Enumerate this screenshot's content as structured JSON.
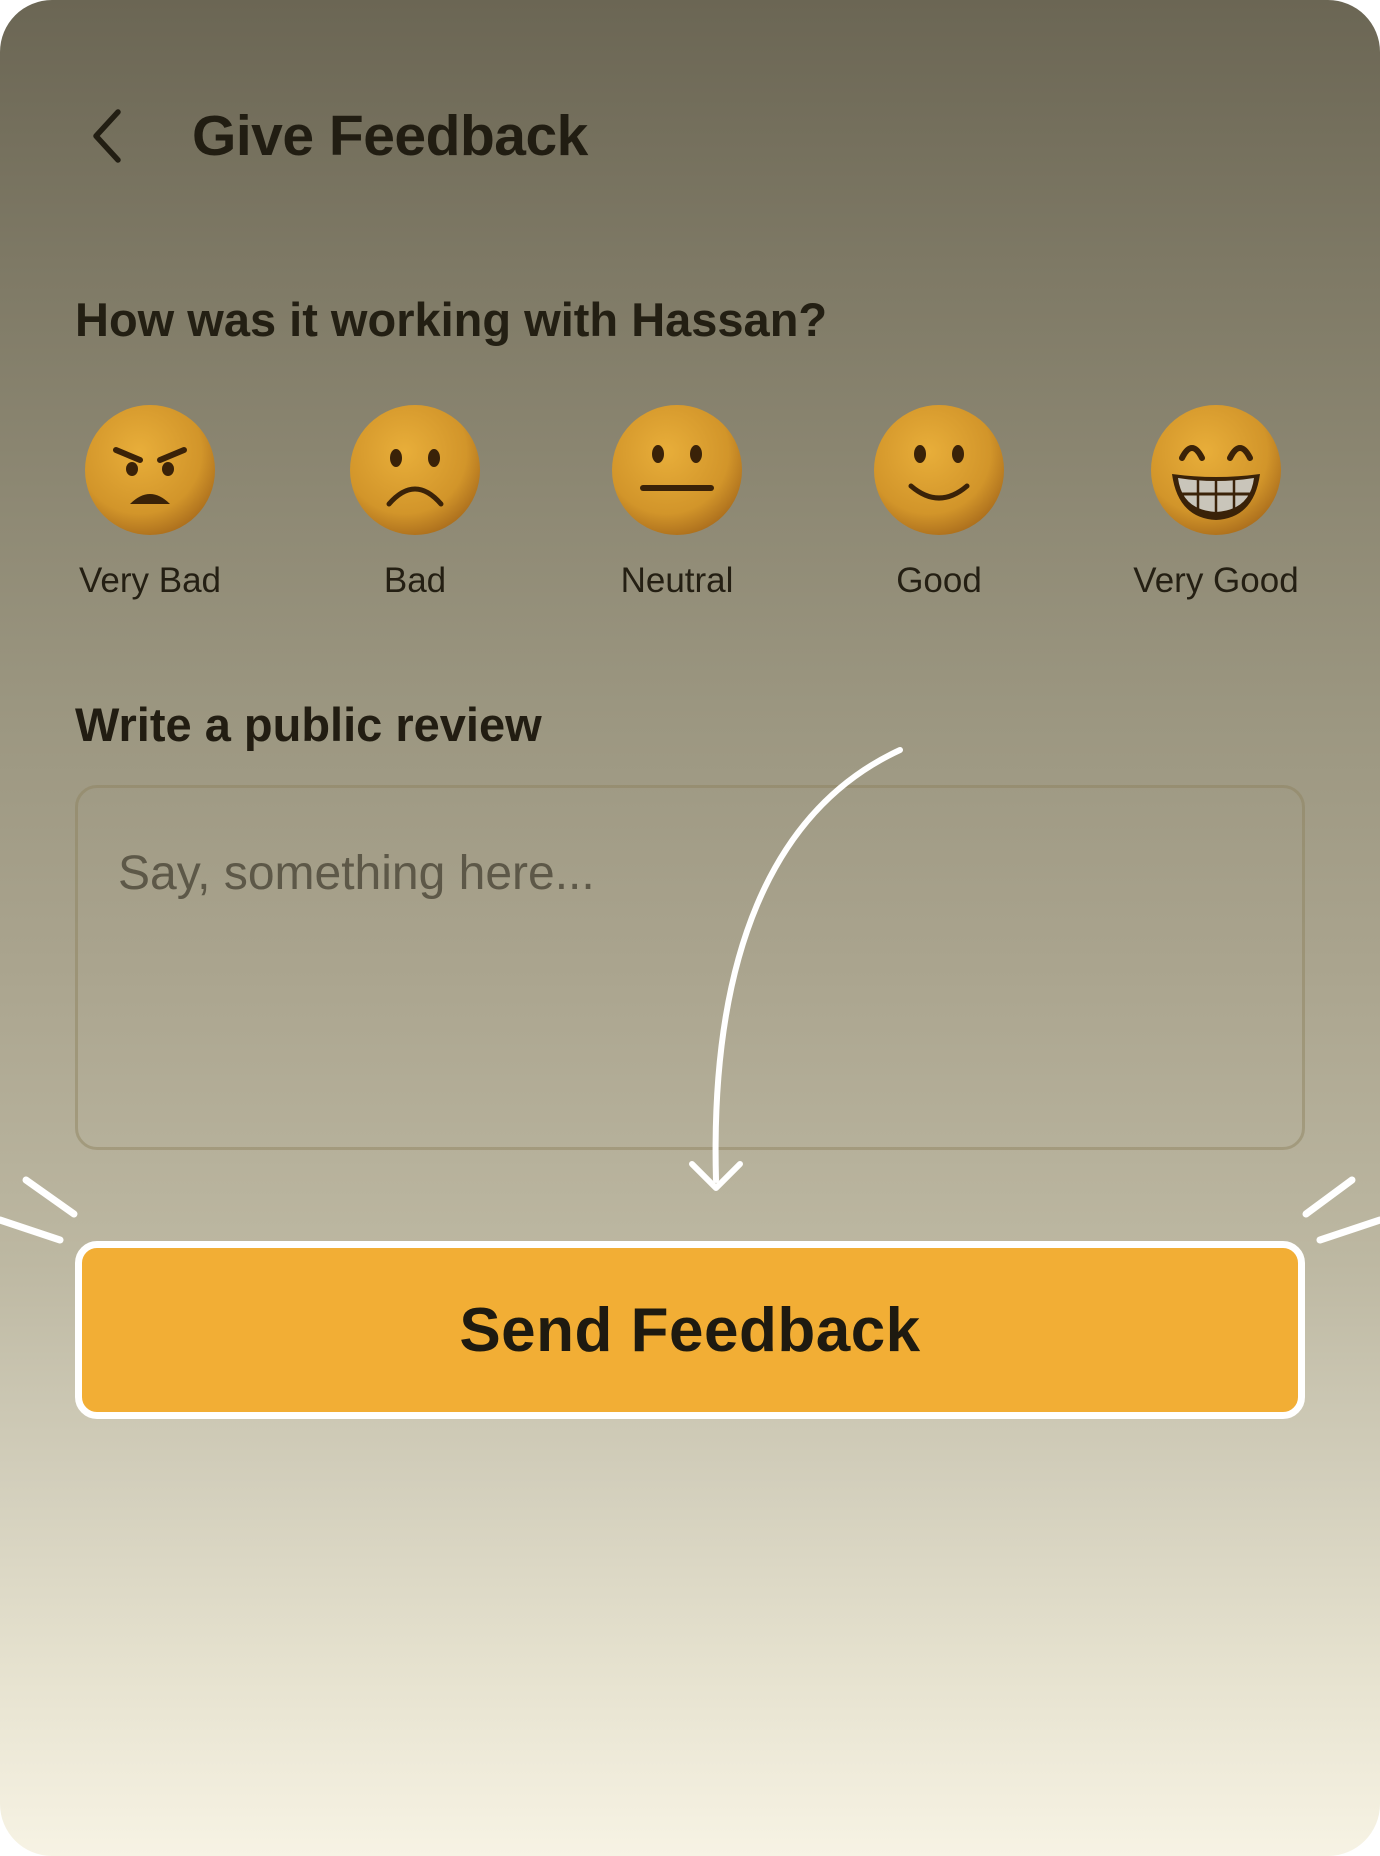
{
  "header": {
    "title": "Give Feedback",
    "back_icon": "chevron-left-icon"
  },
  "rating_section": {
    "question": "How was it working with Hassan?",
    "options": [
      {
        "label": "Very Bad",
        "icon": "angry-face-icon"
      },
      {
        "label": "Bad",
        "icon": "frowning-face-icon"
      },
      {
        "label": "Neutral",
        "icon": "neutral-face-icon"
      },
      {
        "label": "Good",
        "icon": "slightly-smiling-face-icon"
      },
      {
        "label": "Very Good",
        "icon": "grinning-face-icon"
      }
    ]
  },
  "review_section": {
    "title": "Write a public review",
    "placeholder": "Say, something here...",
    "value": ""
  },
  "submit": {
    "label": "Send Feedback"
  },
  "colors": {
    "accent": "#f2ae35",
    "emoji": "#d89b2a",
    "text": "#211d12"
  }
}
